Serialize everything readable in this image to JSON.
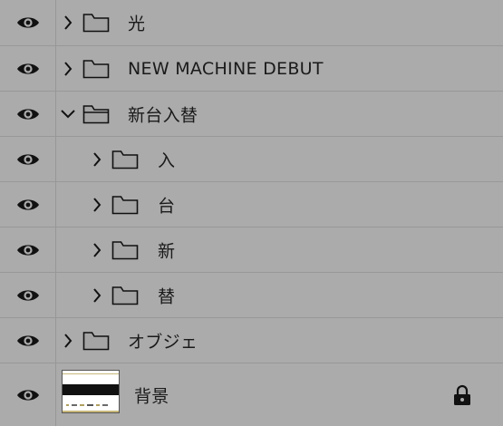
{
  "layers": [
    {
      "name": "光",
      "type": "group",
      "expanded": false,
      "depth": 0
    },
    {
      "name": "NEW MACHINE DEBUT",
      "type": "group",
      "expanded": false,
      "depth": 0
    },
    {
      "name": "新台入替",
      "type": "group",
      "expanded": true,
      "depth": 0
    },
    {
      "name": "入",
      "type": "group",
      "expanded": false,
      "depth": 1
    },
    {
      "name": "台",
      "type": "group",
      "expanded": false,
      "depth": 1
    },
    {
      "name": "新",
      "type": "group",
      "expanded": false,
      "depth": 1
    },
    {
      "name": "替",
      "type": "group",
      "expanded": false,
      "depth": 1
    },
    {
      "name": "オブジェ",
      "type": "group",
      "expanded": false,
      "depth": 0
    },
    {
      "name": "背景",
      "type": "image",
      "locked": true,
      "depth": 0
    }
  ],
  "icons": {
    "visibility": "eye-icon",
    "expand": "chevron-right-icon",
    "collapse": "chevron-down-icon",
    "folder": "folder-icon",
    "lock": "lock-icon"
  },
  "colors": {
    "panel_bg": "#ababab",
    "divider": "#979797",
    "text": "#1a1a1a"
  }
}
